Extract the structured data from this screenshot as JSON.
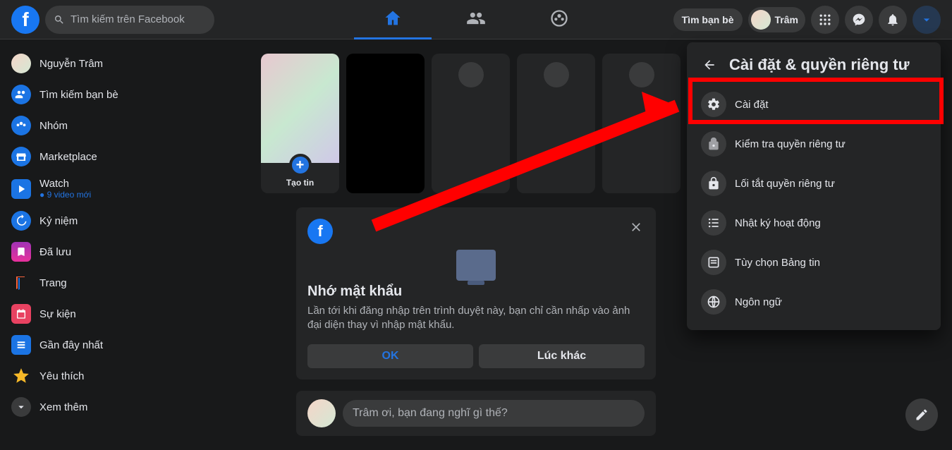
{
  "header": {
    "search_placeholder": "Tìm kiếm trên Facebook",
    "find_friends": "Tìm bạn bè",
    "profile_name": "Trâm"
  },
  "sidebar": {
    "items": [
      {
        "label": "Nguyễn Trâm",
        "icon": "avatar"
      },
      {
        "label": "Tìm kiếm bạn bè",
        "icon": "friends",
        "color": "#1b74e4"
      },
      {
        "label": "Nhóm",
        "icon": "groups",
        "color": "#1b74e4"
      },
      {
        "label": "Marketplace",
        "icon": "marketplace",
        "color": "#1b74e4"
      },
      {
        "label": "Watch",
        "icon": "watch",
        "color": "#1b74e4",
        "sub": "● 9 video mới"
      },
      {
        "label": "Kỷ niệm",
        "icon": "memories",
        "color": "#1b74e4"
      },
      {
        "label": "Đã lưu",
        "icon": "saved",
        "color": "#a033b6"
      },
      {
        "label": "Trang",
        "icon": "pages",
        "color": "#f7633d"
      },
      {
        "label": "Sự kiện",
        "icon": "events",
        "color": "#e84261"
      },
      {
        "label": "Gần đây nhất",
        "icon": "recent",
        "color": "#1b74e4"
      },
      {
        "label": "Yêu thích",
        "icon": "favorites",
        "color": "#f7b928"
      },
      {
        "label": "Xem thêm",
        "icon": "more",
        "color": "#3a3b3c"
      }
    ]
  },
  "stories": {
    "create_label": "Tạo tin"
  },
  "remember_card": {
    "title": "Nhớ mật khẩu",
    "text": "Lần tới khi đăng nhập trên trình duyệt này, bạn chỉ cần nhấp vào ảnh đại diện thay vì nhập mật khẩu.",
    "ok": "OK",
    "later": "Lúc khác"
  },
  "composer": {
    "placeholder": "Trâm ơi, bạn đang nghĩ gì thế?"
  },
  "dropdown": {
    "title": "Cài đặt & quyền riêng tư",
    "items": [
      {
        "label": "Cài đặt",
        "icon": "gear"
      },
      {
        "label": "Kiểm tra quyền riêng tư",
        "icon": "lock-open"
      },
      {
        "label": "Lối tắt quyền riêng tư",
        "icon": "lock"
      },
      {
        "label": "Nhật ký hoạt động",
        "icon": "list"
      },
      {
        "label": "Tùy chọn Bảng tin",
        "icon": "feed"
      },
      {
        "label": "Ngôn ngữ",
        "icon": "globe"
      }
    ]
  }
}
